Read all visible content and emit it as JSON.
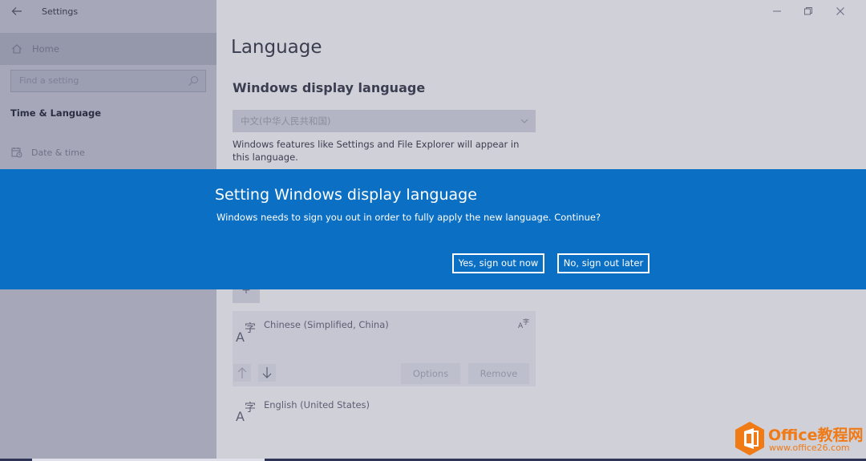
{
  "app": {
    "title": "Settings"
  },
  "sidebar": {
    "home_label": "Home",
    "search_placeholder": "Find a setting",
    "section_label": "Time & Language",
    "items": [
      {
        "label": "Date & time",
        "icon": "calendar-clock-icon"
      }
    ]
  },
  "main": {
    "page_title": "Language",
    "display_language": {
      "heading": "Windows display language",
      "selected_value": "中文(中华人民共和国)",
      "description": "Windows features like Settings and File Explorer will appear in this language."
    },
    "add_button_label": "+",
    "languages": [
      {
        "name": "Chinese (Simplified, China)",
        "icon": "language-az-icon"
      },
      {
        "name": "English (United States)",
        "icon": "language-az-icon"
      }
    ],
    "card_buttons": {
      "options": "Options",
      "remove": "Remove"
    }
  },
  "dialog": {
    "title": "Setting Windows display language",
    "message": "Windows needs to sign you out in order to fully apply the new language. Continue?",
    "confirm_label": "Yes, sign out now",
    "cancel_label": "No, sign out later",
    "background_color": "#0b6fc3"
  },
  "watermark": {
    "brand": "Office教程网",
    "url": "www.office26.com",
    "color": "#f07a16"
  }
}
